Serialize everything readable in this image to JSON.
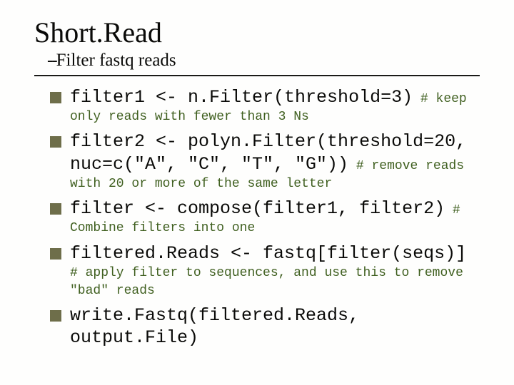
{
  "title": "Short.Read",
  "subtitle_dash": "--",
  "subtitle_text": "Filter fastq reads",
  "items": [
    {
      "line1a": "filter1 <- n.Filter(threshold=",
      "line1num": "3",
      "line1b": ")",
      "comment_inline": " # keep",
      "comment_cont": "only reads with fewer than 3 Ns"
    },
    {
      "line1a": "filter2 <- polyn.Filter(threshold=",
      "line1num": "20",
      "line1b": ",",
      "line2": "nuc=c(\"A\", \"C\", \"T\", \"G\"))",
      "comment_inline": " # remove reads",
      "comment_cont": "with 20 or more of the same letter"
    },
    {
      "line1a": "filter <- compose(filter1, filter2)",
      "comment_inline": " #",
      "comment_cont": "Combine filters into one"
    },
    {
      "line1a": "filtered.Reads <- fastq[filter(seqs)]",
      "comment_cont": "# apply filter to sequences, and use this to remove \"bad\" reads"
    },
    {
      "line1a": "write.Fastq(filtered.Reads, output.File)"
    }
  ]
}
